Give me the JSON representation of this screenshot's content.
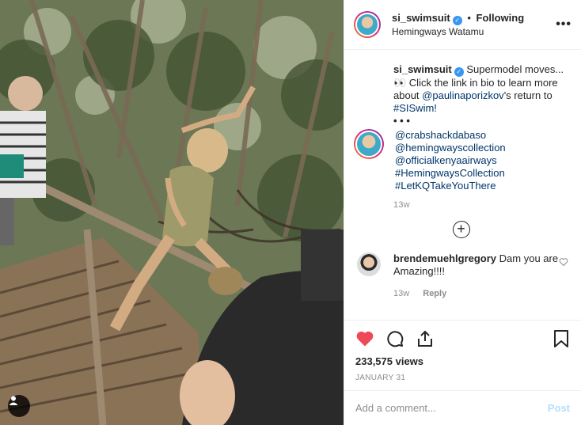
{
  "post": {
    "username": "si_swimsuit",
    "follow_status": "Following",
    "location": "Hemingways Watamu",
    "more_icon": "ellipsis-icon"
  },
  "caption": {
    "username": "si_swimsuit",
    "text_part1": "Supermodel moves... 👀 Click the link in bio to learn more about ",
    "mention": "@paulinaporizkov",
    "text_part2": "'s return to ",
    "hashtag": "#SISwim!",
    "dots": "• • •",
    "tags": [
      "@crabshackdabaso",
      "@hemingwayscollection",
      "@officialkenyaairways",
      "#HemingwaysCollection",
      "#LetKQTakeYouThere"
    ],
    "time": "13w"
  },
  "comments": [
    {
      "username": "brendemuehlgregory",
      "text": "Dam you are Amazing!!!!",
      "time": "13w",
      "reply_label": "Reply"
    }
  ],
  "stats": {
    "views": "233,575 views",
    "date": "JANUARY 31",
    "liked": true
  },
  "composer": {
    "placeholder": "Add a comment...",
    "post_label": "Post"
  },
  "colors": {
    "like_red": "#ed4956",
    "link_blue": "#003569",
    "post_disabled": "#b2dffc",
    "verified_blue": "#3897f0"
  }
}
